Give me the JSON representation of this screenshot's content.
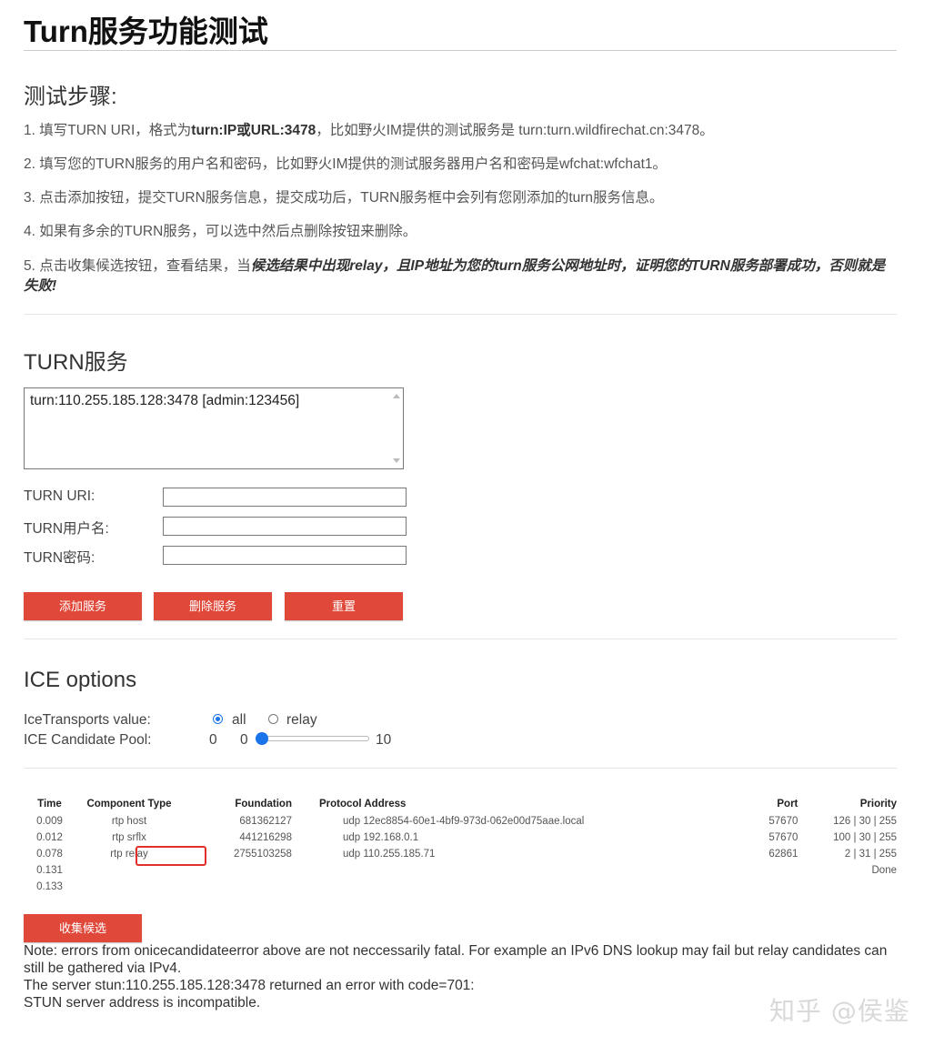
{
  "page": {
    "title": "Turn服务功能测试",
    "steps_heading": "测试步骤:",
    "steps": {
      "s1_a": "1. 填写TURN URI，格式为",
      "s1_b": "turn:IP或URL:3478",
      "s1_c": "，比如野火IM提供的测试服务是 turn:turn.wildfirechat.cn:3478。",
      "s2": "2. 填写您的TURN服务的用户名和密码，比如野火IM提供的测试服务器用户名和密码是wfchat:wfchat1。",
      "s3": "3. 点击添加按钮，提交TURN服务信息，提交成功后，TURN服务框中会列有您刚添加的turn服务信息。",
      "s4": "4. 如果有多余的TURN服务，可以选中然后点删除按钮来删除。",
      "s5_a": "5. 点击收集候选按钮，查看结果，当",
      "s5_b": "候选结果中出现relay，且IP地址为您的turn服务公网地址时，证明您的TURN服务部署成功，否则就是失败",
      "s5_c": "!"
    }
  },
  "turn": {
    "heading": "TURN服务",
    "servers": [
      "turn:110.255.185.128:3478 [admin:123456]"
    ],
    "uri_label": "TURN URI:",
    "user_label": "TURN用户名:",
    "pass_label": "TURN密码:",
    "uri_value": "",
    "user_value": "",
    "pass_value": "",
    "add_button": "添加服务",
    "delete_button": "删除服务",
    "reset_button": "重置"
  },
  "ice": {
    "heading": "ICE options",
    "transports_label": "IceTransports value:",
    "option_all": "all",
    "option_relay": "relay",
    "selected": "all",
    "pool_label": "ICE Candidate Pool:",
    "pool_value": "0",
    "slider_min": "0",
    "slider_max": "10",
    "slider_level": 0
  },
  "candidates": {
    "headers": {
      "time": "Time",
      "component": "Component Type",
      "foundation": "Foundation",
      "protocol": "Protocol Address",
      "port": "Port",
      "priority": "Priority"
    },
    "rows": [
      {
        "time": "0.009",
        "component": "rtp host",
        "foundation": "681362127",
        "protocol": "udp 12ec8854-60e1-4bf9-973d-062e00d75aae.local",
        "port": "57670",
        "priority": "126 | 30 | 255"
      },
      {
        "time": "0.012",
        "component": "rtp srflx",
        "foundation": "441216298",
        "protocol": "udp 192.168.0.1",
        "port": "57670",
        "priority": "100 | 30 | 255"
      },
      {
        "time": "0.078",
        "component": "rtp relay",
        "foundation": "2755103258",
        "protocol": "udp 110.255.185.71",
        "port": "62861",
        "priority": "2 | 31 | 255"
      },
      {
        "time": "0.131",
        "component": "",
        "foundation": "",
        "protocol": "",
        "port": "",
        "priority": "Done"
      },
      {
        "time": "0.133",
        "component": "",
        "foundation": "",
        "protocol": "",
        "port": "",
        "priority": ""
      }
    ],
    "gather_button": "收集候选"
  },
  "note": {
    "line1": "Note: errors from onicecandidateerror above are not neccessarily fatal. For example an IPv6 DNS lookup may fail but relay candidates can still be gathered via IPv4.",
    "line2": "The server stun:110.255.185.128:3478 returned an error with code=701:",
    "line3": "STUN server address is incompatible."
  },
  "watermark": "知乎 @侯鉴",
  "colors": {
    "button": "#e0483a",
    "highlight": "#e0322a",
    "accent": "#1a73e8"
  }
}
